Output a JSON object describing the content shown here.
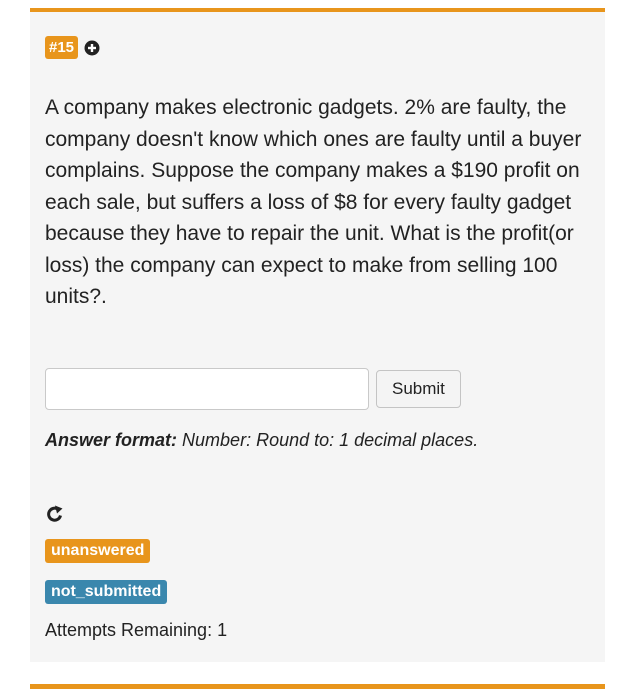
{
  "question": {
    "number_badge": "#15",
    "text": "A company makes electronic gadgets. 2% are faulty, the company doesn't know which ones are faulty until a buyer complains. Suppose the company makes a $190 profit on each sale, but suffers a loss of $8 for every faulty gadget because they have to repair the unit. What is the profit(or loss) the company can expect to make from selling 100 units?."
  },
  "answer": {
    "input_value": "",
    "submit_label": "Submit",
    "format_label": "Answer format:",
    "format_text": "Number: Round to: 1 decimal places."
  },
  "status": {
    "answer_state": "unanswered",
    "submit_state": "not_submitted",
    "attempts_label": "Attempts Remaining: 1"
  },
  "colors": {
    "accent_orange": "#e8951c",
    "info_blue": "#3a87ad",
    "card_background": "#f5f5f5"
  },
  "icons": {
    "add": "plus-circle-icon",
    "reload": "share-reload-icon"
  }
}
